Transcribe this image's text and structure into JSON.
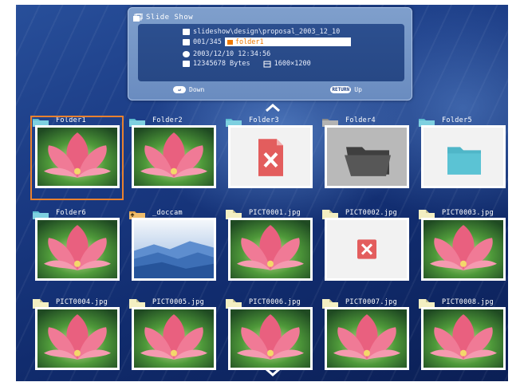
{
  "colors": {
    "accent": "#e8812f",
    "panel": "#6a8cc0",
    "folder": "#5bbcd0",
    "error": "#e35d5d",
    "file": "#f3efc2"
  },
  "panel": {
    "title": "Slide Show",
    "path": "slideshow\\design\\proposal_2003_12_10",
    "counter": "001/345",
    "folder_name": "folder1",
    "datetime": "2003/12/10 12:34:56",
    "filesize": "12345678 Bytes",
    "resolution": "1600×1200",
    "down_label": "Down",
    "return_key": "RETURN",
    "up_label": "Up",
    "icons": [
      "slideshow-icon",
      "path-icon",
      "counter-icon",
      "folder-icon",
      "clock-icon",
      "size-icon",
      "resolution-icon",
      "enter-key-icon"
    ]
  },
  "grid": {
    "selected_index": 0,
    "items": [
      {
        "label": "Folder1",
        "kind": "folder",
        "thumb": "flower"
      },
      {
        "label": "Folder2",
        "kind": "folder",
        "thumb": "flower"
      },
      {
        "label": "Folder3",
        "kind": "folder",
        "thumb": "error-file"
      },
      {
        "label": "Folder4",
        "kind": "folder-gray",
        "thumb": "dark-folder"
      },
      {
        "label": "Folder5",
        "kind": "folder",
        "thumb": "empty-folder"
      },
      {
        "label": "Folder6",
        "kind": "folder",
        "thumb": "flower"
      },
      {
        "label": "_doccam",
        "kind": "folder-up",
        "thumb": "mountains"
      },
      {
        "label": "PICT0001.jpg",
        "kind": "file",
        "thumb": "flower"
      },
      {
        "label": "PICT0002.jpg",
        "kind": "file",
        "thumb": "error"
      },
      {
        "label": "PICT0003.jpg",
        "kind": "file",
        "thumb": "flower"
      },
      {
        "label": "PICT0004.jpg",
        "kind": "file",
        "thumb": "flower"
      },
      {
        "label": "PICT0005.jpg",
        "kind": "file",
        "thumb": "flower"
      },
      {
        "label": "PICT0006.jpg",
        "kind": "file",
        "thumb": "flower"
      },
      {
        "label": "PICT0007.jpg",
        "kind": "file",
        "thumb": "flower"
      },
      {
        "label": "PICT0008.jpg",
        "kind": "file",
        "thumb": "flower"
      }
    ]
  },
  "nav": {
    "up_icon": "chevron-up-icon",
    "down_icon": "chevron-down-icon"
  }
}
